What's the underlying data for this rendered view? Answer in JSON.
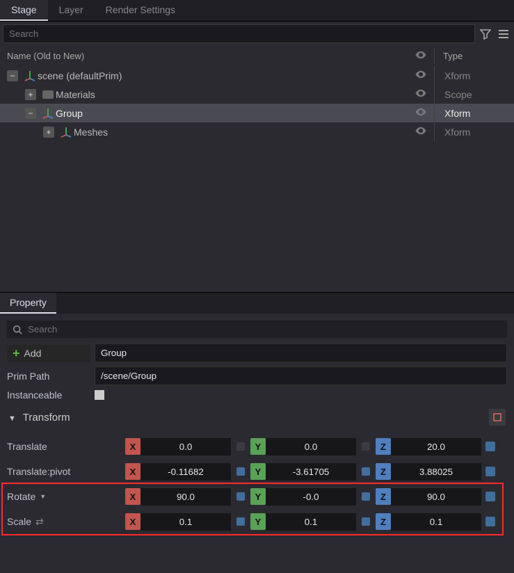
{
  "tabs": [
    "Stage",
    "Layer",
    "Render Settings"
  ],
  "tabs_active": 0,
  "search_placeholder": "Search",
  "tree_header": {
    "name": "Name (Old to New)",
    "type": "Type"
  },
  "tree": [
    {
      "indent": 0,
      "expander": "-",
      "icon": "axes",
      "label": "scene (defaultPrim)",
      "type": "Xform",
      "selected": false
    },
    {
      "indent": 1,
      "expander": "+",
      "icon": "folder",
      "label": "Materials",
      "type": "Scope",
      "selected": false
    },
    {
      "indent": 1,
      "expander": "-",
      "icon": "axes",
      "label": "Group",
      "type": "Xform",
      "selected": true
    },
    {
      "indent": 2,
      "expander": "+",
      "icon": "axes",
      "label": "Meshes",
      "type": "Xform",
      "selected": false
    }
  ],
  "prop_tab": "Property",
  "prop_search_placeholder": "Search",
  "add_label": "Add",
  "name_field": "Group",
  "prim_path_label": "Prim Path",
  "prim_path_value": "/scene/Group",
  "instanceable_label": "Instanceable",
  "transform_title": "Transform",
  "rows": [
    {
      "label": "Translate",
      "x": "0.0",
      "y": "0.0",
      "z": "20.0",
      "mx": "off",
      "my": "off",
      "end": true,
      "dropdown": false
    },
    {
      "label": "Translate:pivot",
      "x": "-0.11682",
      "y": "-3.61705",
      "z": "3.88025",
      "mx": "on",
      "my": "on",
      "end": true,
      "dropdown": false
    },
    {
      "label": "Rotate",
      "x": "90.0",
      "y": "-0.0",
      "z": "90.0",
      "mx": "on",
      "my": "on",
      "end": true,
      "dropdown": true
    },
    {
      "label": "Scale",
      "x": "0.1",
      "y": "0.1",
      "z": "0.1",
      "mx": "on",
      "my": "on",
      "end": true,
      "dropdown": false,
      "link": true
    }
  ]
}
